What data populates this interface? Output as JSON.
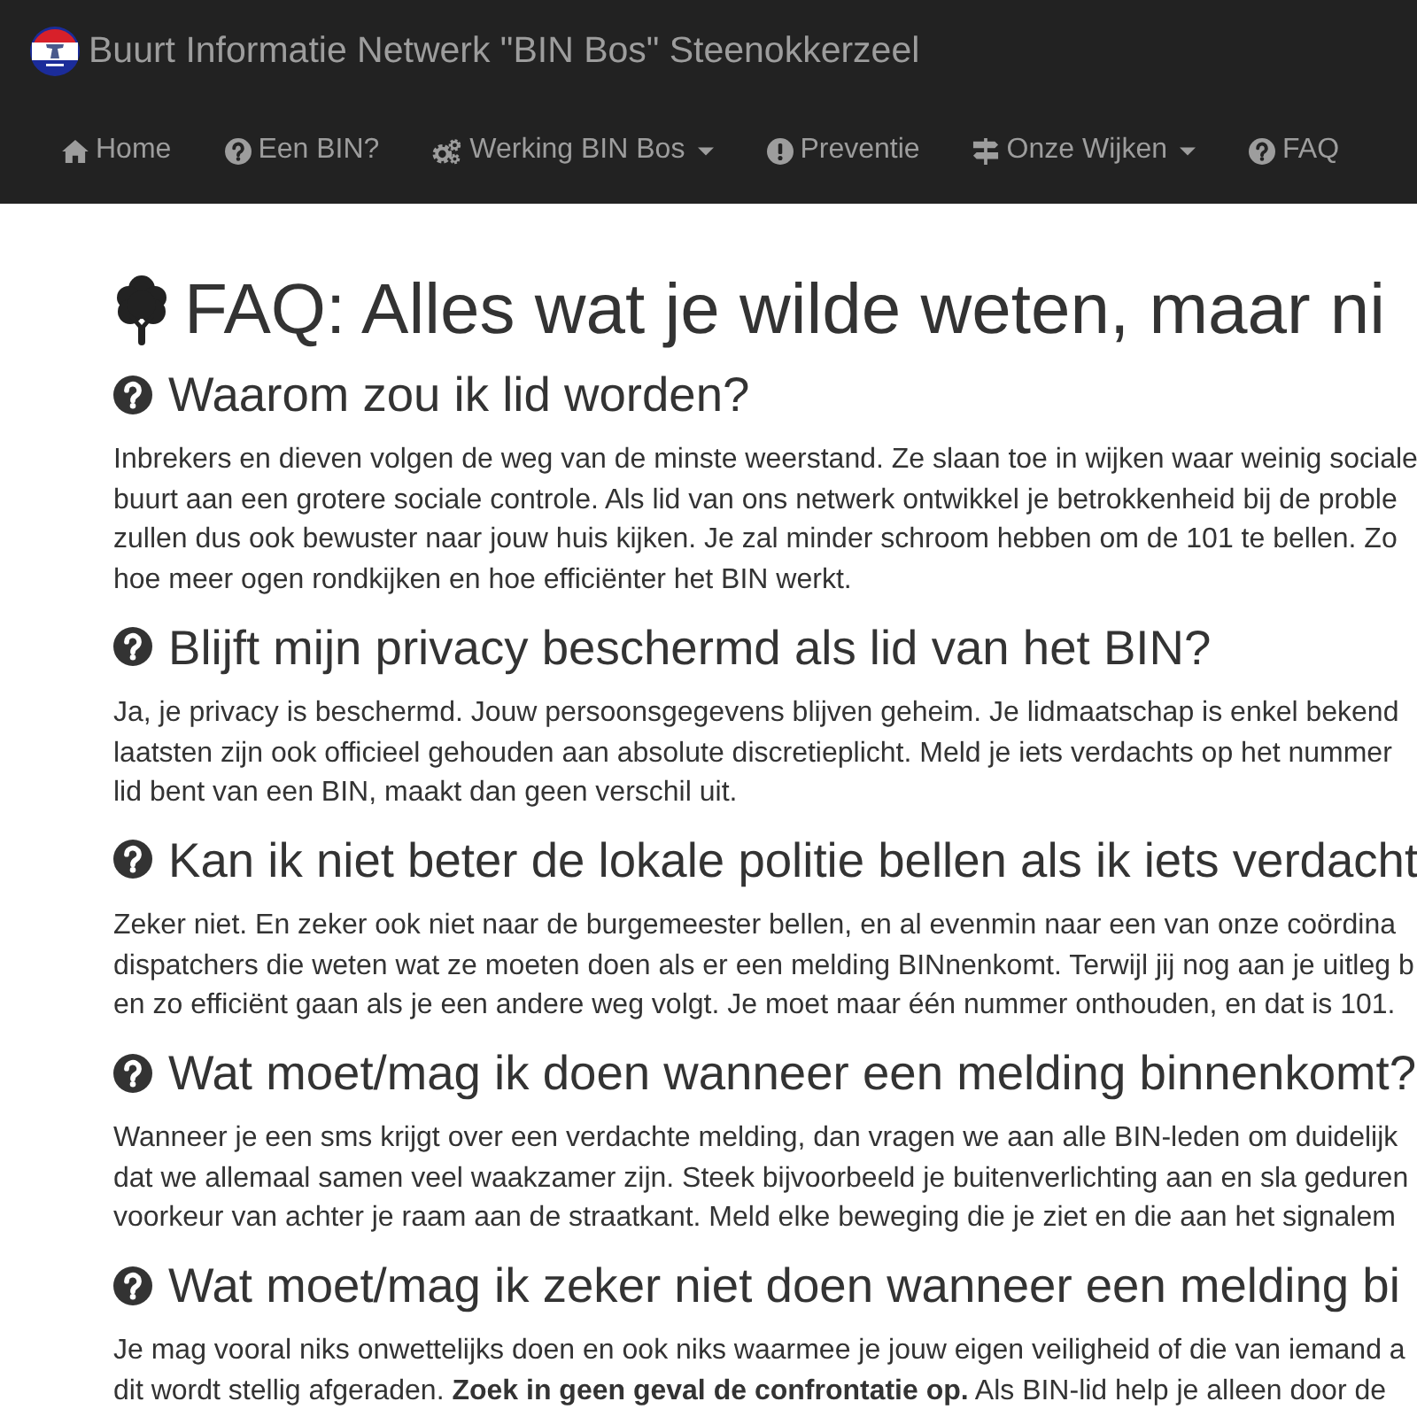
{
  "navbar": {
    "brand": "Buurt Informatie Netwerk \"BIN Bos\" Steenokkerzeel",
    "items": [
      {
        "label": "Home",
        "dropdown": false
      },
      {
        "label": "Een BIN?",
        "dropdown": false
      },
      {
        "label": "Werking BIN Bos",
        "dropdown": true
      },
      {
        "label": "Preventie",
        "dropdown": false
      },
      {
        "label": "Onze Wijken",
        "dropdown": true
      },
      {
        "label": "FAQ",
        "dropdown": false
      }
    ]
  },
  "page": {
    "title": "FAQ: Alles wat je wilde weten, maar ni",
    "sections": [
      {
        "question": "Waarom zou ik lid worden?",
        "answer_lines": [
          "Inbrekers en dieven volgen de weg van de minste weerstand. Ze slaan toe in wijken waar weinig sociale",
          "buurt aan een grotere sociale controle. Als lid van ons netwerk ontwikkel je betrokkenheid bij de proble",
          "zullen dus ook bewuster naar jouw huis kijken. Je zal minder schroom hebben om de 101 te bellen. Zo",
          "hoe meer ogen rondkijken en hoe efficiënter het BIN werkt."
        ]
      },
      {
        "question": "Blijft mijn privacy beschermd als lid van het BIN?",
        "answer_lines": [
          "Ja, je privacy is beschermd. Jouw persoonsgegevens blijven geheim. Je lidmaatschap is enkel bekend",
          "laatsten zijn ook officieel gehouden aan absolute discretieplicht. Meld je iets verdachts op het nummer",
          "lid bent van een BIN, maakt dan geen verschil uit."
        ]
      },
      {
        "question": "Kan ik niet beter de lokale politie bellen als ik iets verdacht",
        "answer_lines": [
          "Zeker niet. En zeker ook niet naar de burgemeester bellen, en al evenmin naar een van onze coördina",
          "dispatchers die weten wat ze moeten doen als er een melding BINnenkomt. Terwijl jij nog aan je uitleg b",
          "en zo efficiënt gaan als je een andere weg volgt. Je moet maar één nummer onthouden, en dat is 101."
        ]
      },
      {
        "question": "Wat moet/mag ik doen wanneer een melding binnenkomt?",
        "answer_lines": [
          "Wanneer je een sms krijgt over een verdachte melding, dan vragen we aan alle BIN-leden om duidelijk",
          "dat we allemaal samen veel waakzamer zijn. Steek bijvoorbeeld je buitenverlichting aan en sla geduren",
          "voorkeur van achter je raam aan de straatkant. Meld elke beweging die je ziet en die aan het signalem"
        ]
      },
      {
        "question": "Wat moet/mag ik zeker niet doen wanneer een melding bi",
        "answer_lines": [
          "Je mag vooral niks onwettelijks doen en ook niks waarmee je jouw eigen veiligheid of die van iemand a",
          "dit wordt stellig afgeraden. **Zoek in geen geval de confrontatie op.** Als BIN-lid help je alleen door de"
        ]
      }
    ]
  }
}
